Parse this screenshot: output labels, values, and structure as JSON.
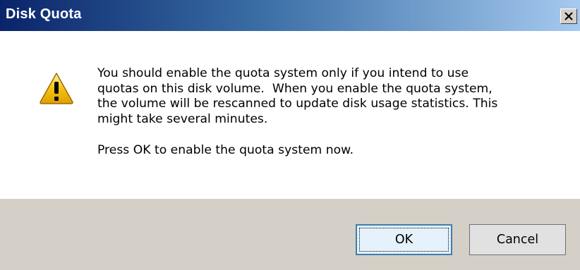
{
  "window": {
    "title": "Disk Quota"
  },
  "icons": {
    "warning": "warning-icon",
    "close": "close-icon"
  },
  "message": {
    "paragraph1": "You should enable the quota system only if you intend to use\nquotas on this disk volume.  When you enable the quota system,\nthe volume will be rescanned to update disk usage statistics. This\nmight take several minutes.",
    "paragraph2": "Press OK to enable the quota system now."
  },
  "buttons": {
    "ok_label": "OK",
    "cancel_label": "Cancel"
  },
  "colors": {
    "title_gradient_start": "#0a246a",
    "title_gradient_end": "#a6caf0",
    "warning_fill": "#f5c211",
    "dialog_face": "#d4d0c8"
  }
}
